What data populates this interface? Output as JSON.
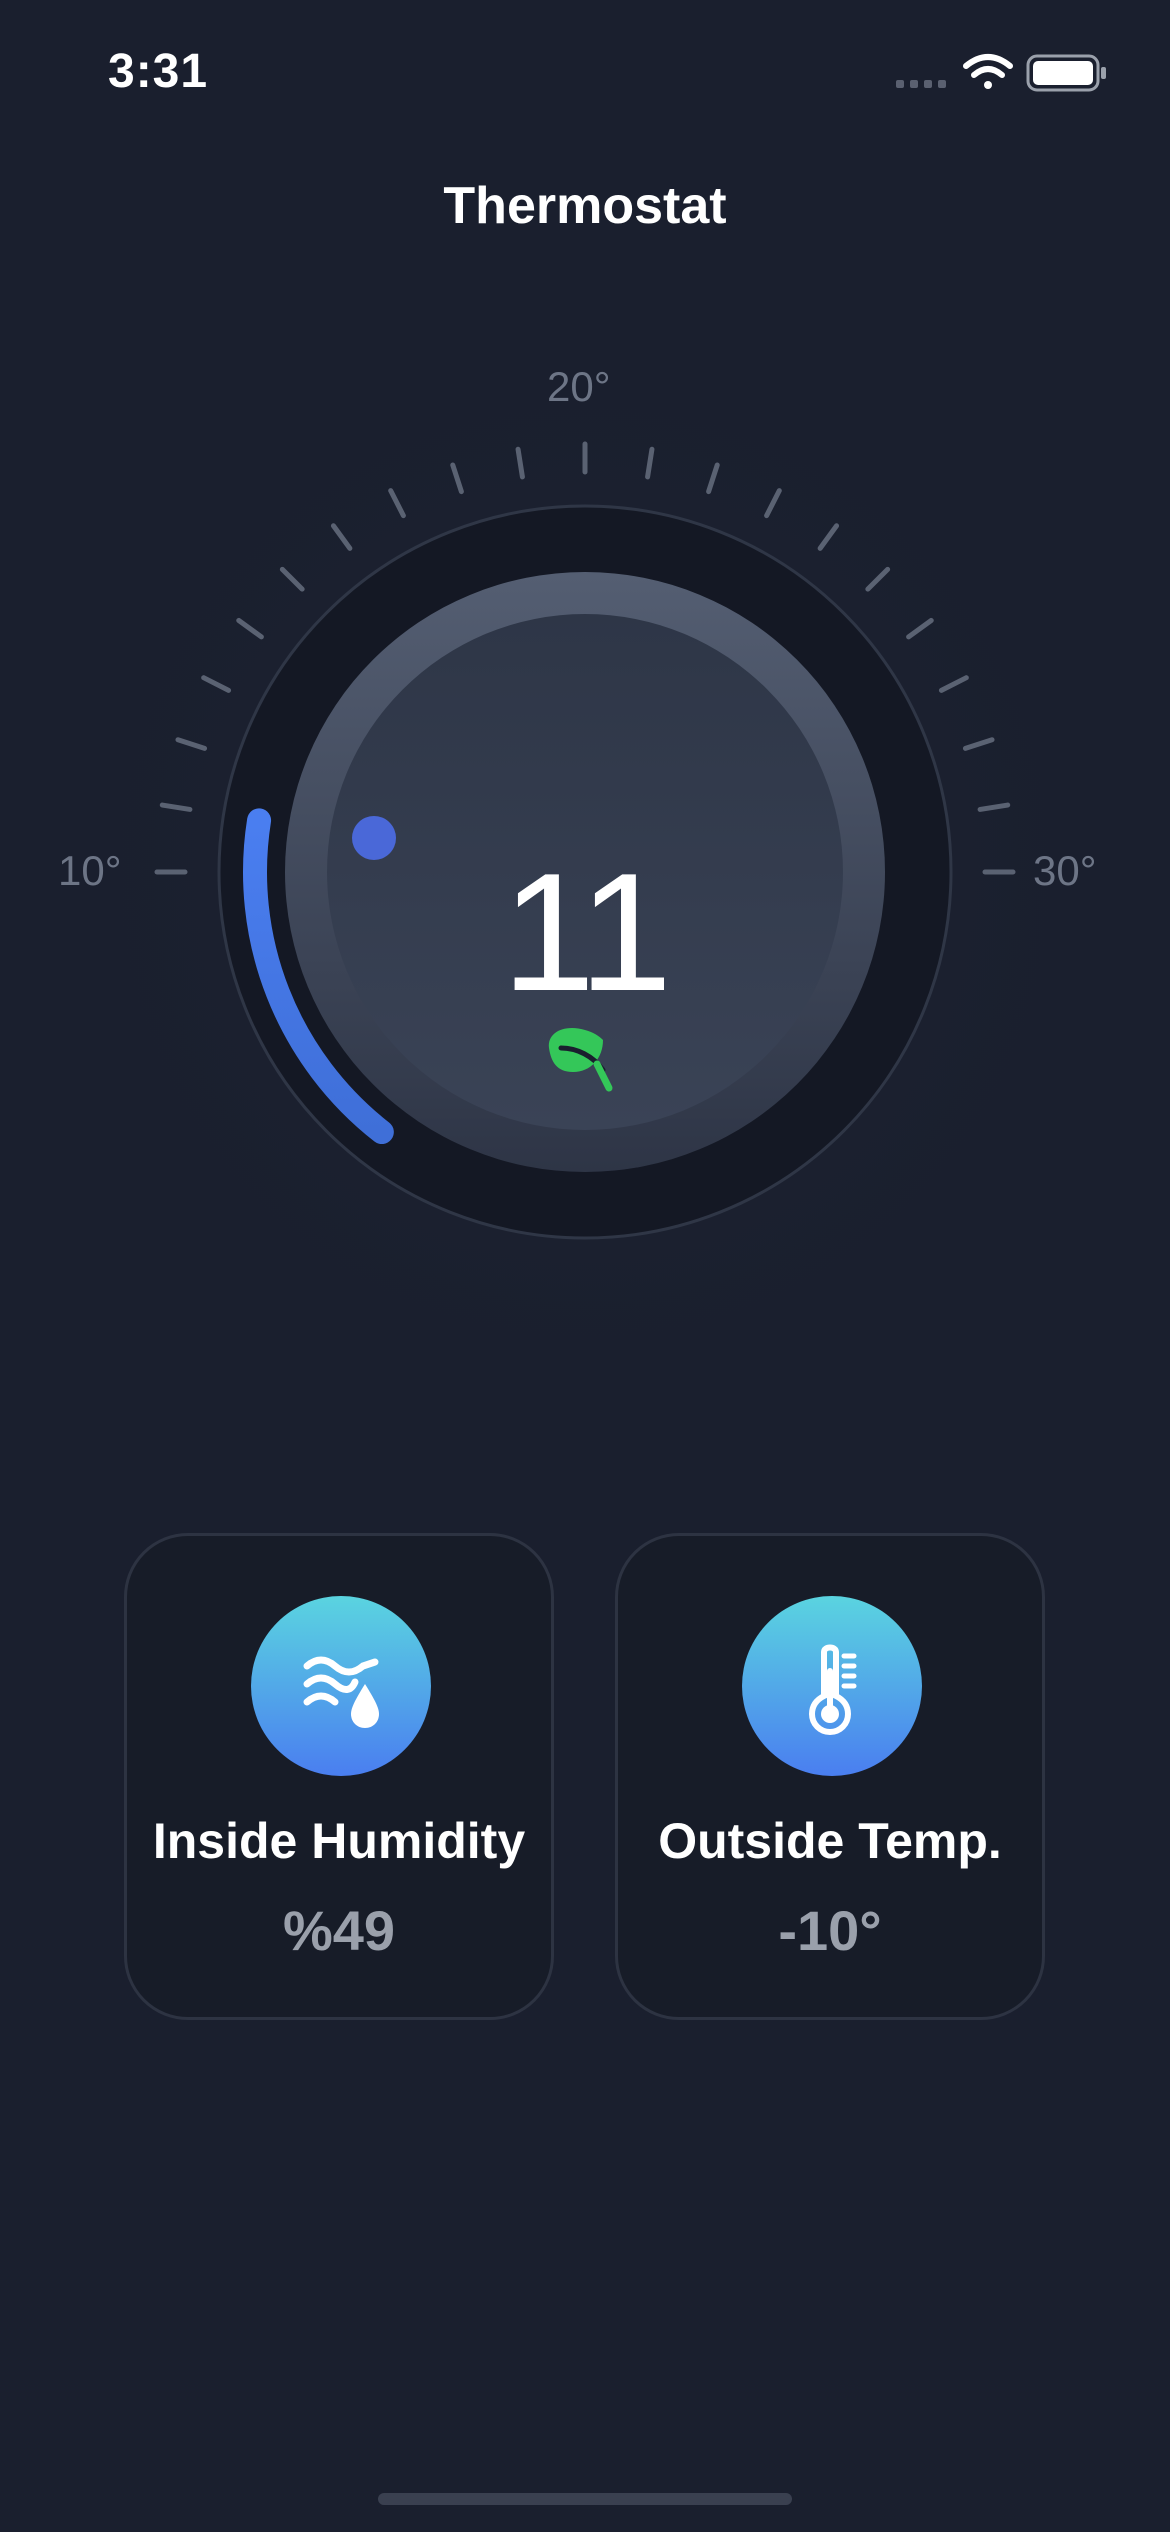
{
  "status_bar": {
    "time": "3:31",
    "icons": [
      "signal-icon",
      "wifi-icon",
      "battery-icon"
    ]
  },
  "header": {
    "title": "Thermostat"
  },
  "dial": {
    "min_label": "10°",
    "mid_label": "20°",
    "max_label": "30°",
    "current_value": "11",
    "mode_icon": "leaf-icon",
    "colors": {
      "progress": "#4a7ef0",
      "leaf": "#34c759"
    }
  },
  "cards": [
    {
      "title": "Inside Humidity",
      "value": "%49",
      "icon": "humidity-icon"
    },
    {
      "title": "Outside Temp.",
      "value": "-10°",
      "icon": "thermometer-icon"
    }
  ]
}
